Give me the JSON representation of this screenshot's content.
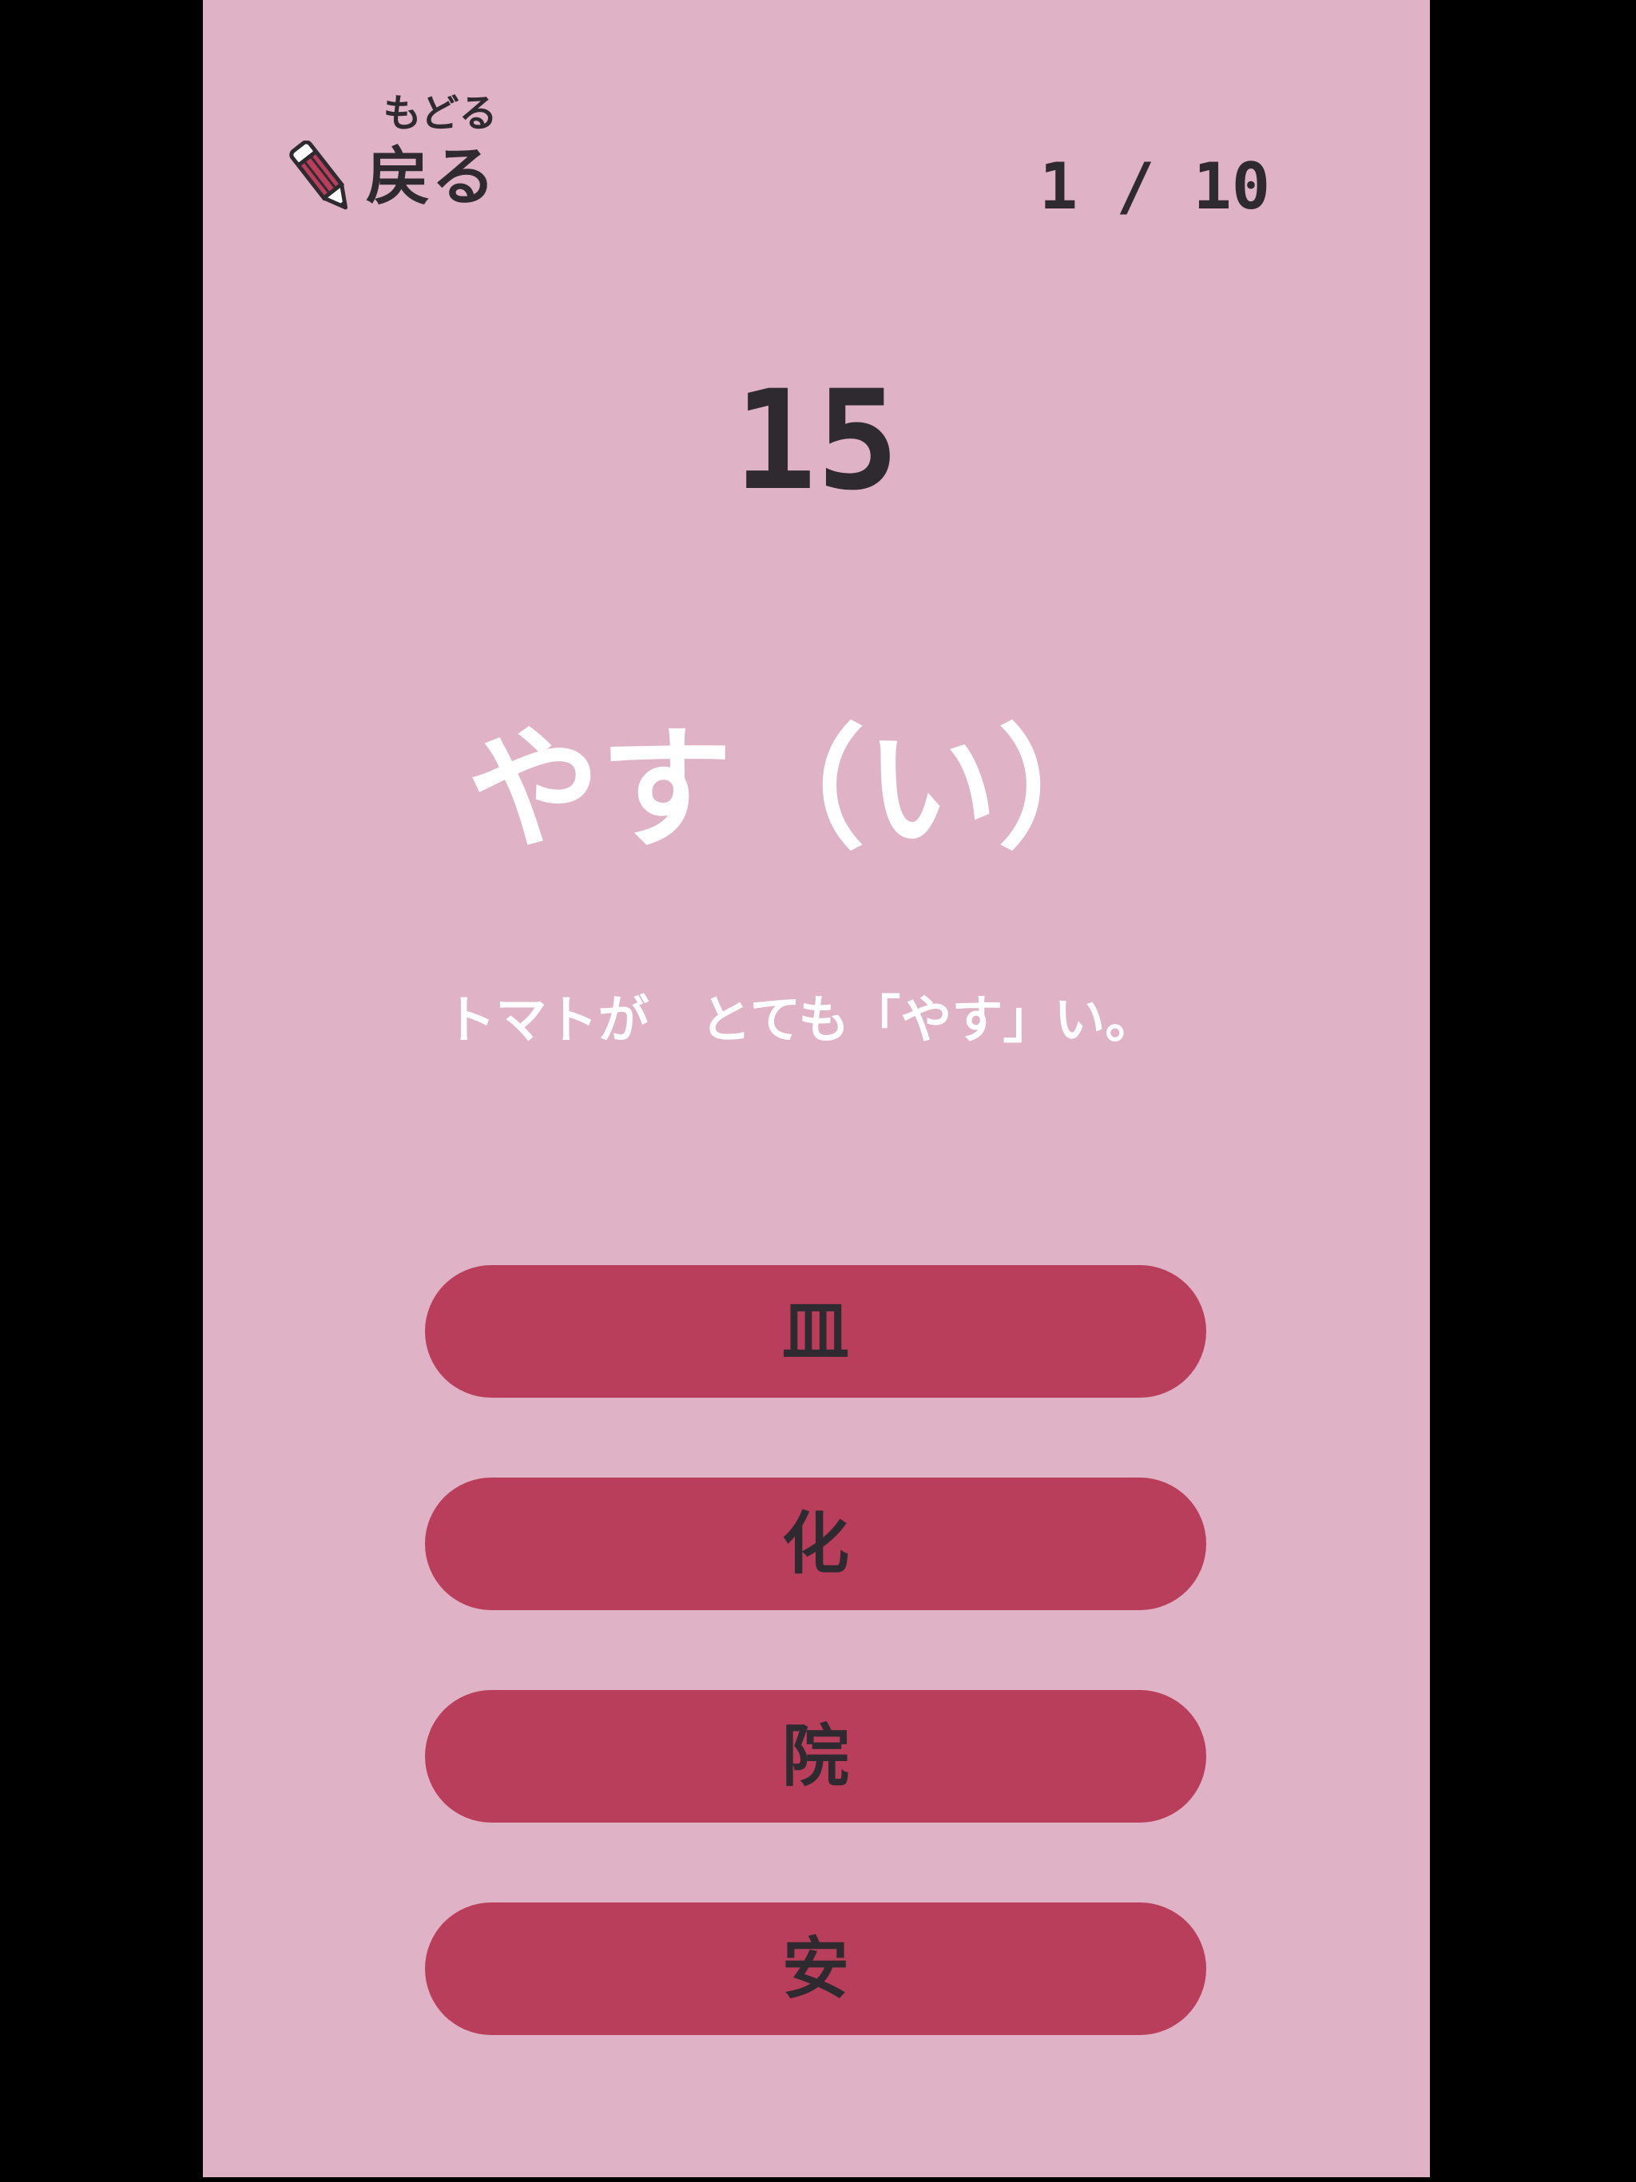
{
  "header": {
    "back_ruby": "もどる",
    "back_label": "戻る",
    "progress": "1 / 10"
  },
  "quiz": {
    "timer": "15",
    "reading": "やす（い）",
    "sentence": "トマトが　とても「やす」い。",
    "choices": [
      {
        "label": "皿"
      },
      {
        "label": "化"
      },
      {
        "label": "院"
      },
      {
        "label": "安"
      }
    ]
  },
  "colors": {
    "background": "#e0b2c5",
    "button": "#b83e5b",
    "text_dark": "#2f2a30",
    "text_light": "#ffffff"
  },
  "icons": {
    "back": "pencil-icon"
  }
}
